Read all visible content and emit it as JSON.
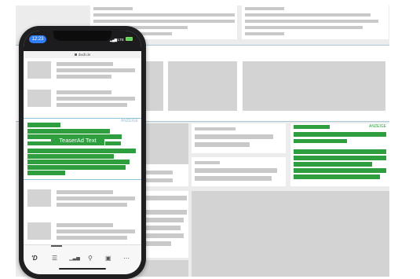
{
  "phone": {
    "status": {
      "time": "12:23",
      "network": "LTE"
    },
    "url": "dwdl.de",
    "ad": {
      "label": "ANZEIGE",
      "teaser_text": "TeaserAd Text"
    },
    "tabbar": {
      "logo": "'D",
      "icons": [
        "list-icon",
        "chart-icon",
        "search-icon",
        "briefcase-icon",
        "more-icon"
      ]
    }
  },
  "desktop": {
    "ad": {
      "label": "ANZEIGE"
    }
  },
  "colors": {
    "ad_green": "#2f9e3f",
    "placeholder_gray": "#d3d3d3",
    "frame_dark": "#1f1f21",
    "accent_blue": "#2f7ef7"
  }
}
